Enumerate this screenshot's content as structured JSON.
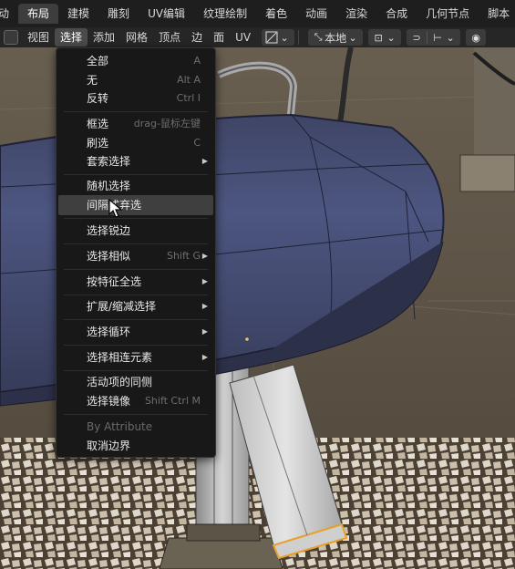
{
  "workspace_tabs": [
    {
      "label": "动",
      "active": false
    },
    {
      "label": "布局",
      "active": true
    },
    {
      "label": "建模",
      "active": false
    },
    {
      "label": "雕刻",
      "active": false
    },
    {
      "label": "UV编辑",
      "active": false
    },
    {
      "label": "纹理绘制",
      "active": false
    },
    {
      "label": "着色",
      "active": false
    },
    {
      "label": "动画",
      "active": false
    },
    {
      "label": "渲染",
      "active": false
    },
    {
      "label": "合成",
      "active": false
    },
    {
      "label": "几何节点",
      "active": false
    },
    {
      "label": "脚本",
      "active": false
    }
  ],
  "header": {
    "menus": [
      {
        "label": "视图",
        "active": false
      },
      {
        "label": "选择",
        "active": true
      },
      {
        "label": "添加",
        "active": false
      },
      {
        "label": "网格",
        "active": false
      },
      {
        "label": "顶点",
        "active": false
      },
      {
        "label": "边",
        "active": false
      },
      {
        "label": "面",
        "active": false
      },
      {
        "label": "UV",
        "active": false
      }
    ],
    "transform_orientation": "本地"
  },
  "select_menu": {
    "items": [
      {
        "label": "全部",
        "shortcut": "A"
      },
      {
        "label": "无",
        "shortcut": "Alt A"
      },
      {
        "label": "反转",
        "shortcut": "Ctrl I"
      },
      {
        "label": "框选",
        "shortcut": "drag-鼠标左键"
      },
      {
        "label": "刷选",
        "shortcut": "C"
      },
      {
        "label": "套索选择",
        "shortcut": ""
      },
      {
        "label": "随机选择",
        "shortcut": ""
      },
      {
        "label": "间隔式弃选",
        "shortcut": ""
      },
      {
        "label": "选择锐边",
        "shortcut": ""
      },
      {
        "label": "选择相似",
        "shortcut": "Shift G"
      },
      {
        "label": "按特征全选",
        "shortcut": ""
      },
      {
        "label": "扩展/缩减选择",
        "shortcut": ""
      },
      {
        "label": "选择循环",
        "shortcut": ""
      },
      {
        "label": "选择相连元素",
        "shortcut": ""
      },
      {
        "label": "活动项的同侧",
        "shortcut": ""
      },
      {
        "label": "选择镜像",
        "shortcut": "Shift Ctrl M"
      },
      {
        "label": "By Attribute",
        "shortcut": ""
      },
      {
        "label": "取消边界",
        "shortcut": ""
      }
    ]
  },
  "colors": {
    "mesh_face": "#454d73",
    "mesh_edge": "#1f2236",
    "floor": "#5f5446",
    "menu_bg": "#181818",
    "highlight": "#3f3f3f",
    "selected_edge": "#e8a02a"
  }
}
